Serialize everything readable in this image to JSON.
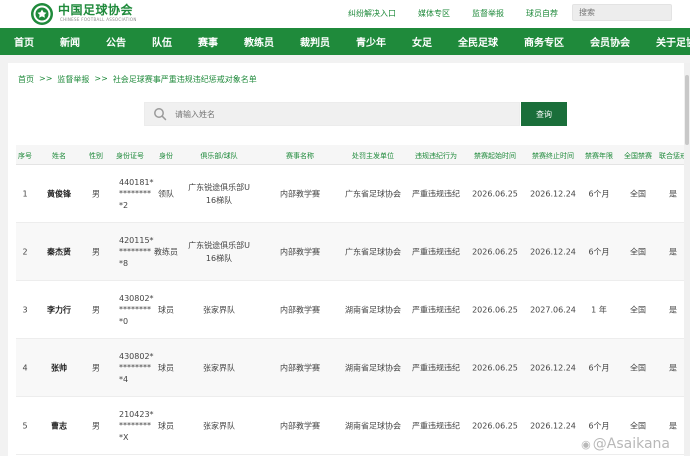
{
  "header": {
    "logo_text": "中国足球协会",
    "logo_sub": "CHINESE FOOTBALL ASSOCIATION",
    "links": [
      "纠纷解决入口",
      "媒体专区",
      "监督举报",
      "球员自荐"
    ],
    "search_placeholder": "搜索",
    "brand_color": "#1f8a3b"
  },
  "nav": {
    "items": [
      "首页",
      "新闻",
      "公告",
      "队伍",
      "赛事",
      "教练员",
      "裁判员",
      "青少年",
      "女足",
      "全民足球",
      "商务专区",
      "会员协会",
      "关于足协"
    ]
  },
  "breadcrumb": {
    "items": [
      "首页",
      "监督举报",
      "社会足球赛事严重违规违纪惩戒对象名单"
    ],
    "separator": ">>"
  },
  "search": {
    "placeholder": "请输入姓名",
    "button_label": "查询",
    "button_color": "#1a6e3a"
  },
  "table": {
    "columns": [
      "序号",
      "姓名",
      "性别",
      "身份证号",
      "身份",
      "俱乐部/球队",
      "赛事名称",
      "处罚主发单位",
      "违规违纪行为",
      "禁赛起始时间",
      "禁赛终止时间",
      "禁赛年限",
      "全国禁赛",
      "联合惩戒"
    ],
    "rows": [
      {
        "no": "1",
        "name": "黄俊锋",
        "gender": "男",
        "id": [
          "440181*",
          "********",
          "*2"
        ],
        "role": "领队",
        "club": [
          "广东锐途俱乐部U",
          "16梯队"
        ],
        "event": "内部教学赛",
        "unit": "广东省足球协会",
        "violation": "严重违规违纪",
        "start": "2026.06.25",
        "end": "2026.12.24",
        "duration": "6个月",
        "national": "全国",
        "joint": "是"
      },
      {
        "no": "2",
        "name": "秦杰贤",
        "gender": "男",
        "id": [
          "420115*",
          "********",
          "*8"
        ],
        "role": "教练员",
        "club": [
          "广东锐途俱乐部U",
          "16梯队"
        ],
        "event": "内部教学赛",
        "unit": "广东省足球协会",
        "violation": "严重违规违纪",
        "start": "2026.06.25",
        "end": "2026.12.24",
        "duration": "6个月",
        "national": "全国",
        "joint": "是"
      },
      {
        "no": "3",
        "name": "李力行",
        "gender": "男",
        "id": [
          "430802*",
          "********",
          "*0"
        ],
        "role": "球员",
        "club": [
          "张家界队"
        ],
        "event": "内部教学赛",
        "unit": "湖南省足球协会",
        "violation": "严重违规违纪",
        "start": "2026.06.25",
        "end": "2027.06.24",
        "duration": "1 年",
        "national": "全国",
        "joint": "是"
      },
      {
        "no": "4",
        "name": "张帅",
        "gender": "男",
        "id": [
          "430802*",
          "********",
          "*4"
        ],
        "role": "球员",
        "club": [
          "张家界队"
        ],
        "event": "内部教学赛",
        "unit": "湖南省足球协会",
        "violation": "严重违规违纪",
        "start": "2026.06.25",
        "end": "2026.12.24",
        "duration": "6个月",
        "national": "全国",
        "joint": "是"
      },
      {
        "no": "5",
        "name": "曹志",
        "gender": "男",
        "id": [
          "210423*",
          "********",
          "*X"
        ],
        "role": "球员",
        "club": [
          "张家界队"
        ],
        "event": "内部教学赛",
        "unit": "湖南省足球协会",
        "violation": "严重违规违纪",
        "start": "2026.06.25",
        "end": "2026.12.24",
        "duration": "6个月",
        "national": "全国",
        "joint": "是"
      }
    ]
  },
  "watermark": "@Asaikana"
}
